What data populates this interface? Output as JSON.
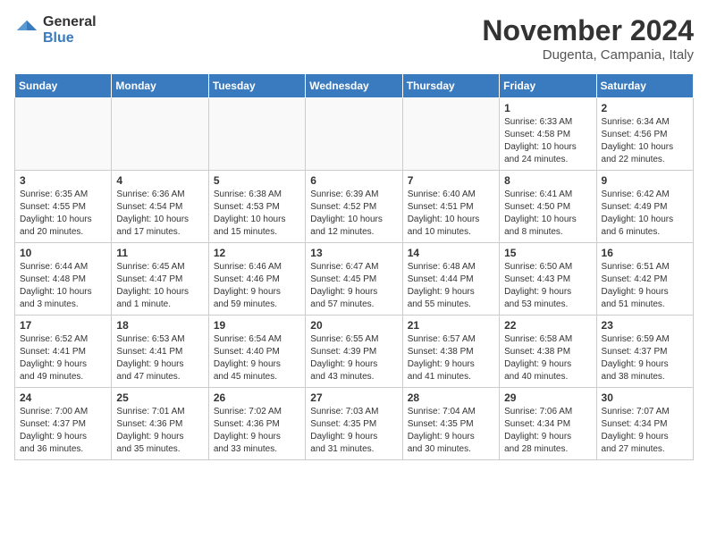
{
  "logo": {
    "general": "General",
    "blue": "Blue"
  },
  "title": "November 2024",
  "subtitle": "Dugenta, Campania, Italy",
  "days_header": [
    "Sunday",
    "Monday",
    "Tuesday",
    "Wednesday",
    "Thursday",
    "Friday",
    "Saturday"
  ],
  "weeks": [
    [
      {
        "day": "",
        "info": ""
      },
      {
        "day": "",
        "info": ""
      },
      {
        "day": "",
        "info": ""
      },
      {
        "day": "",
        "info": ""
      },
      {
        "day": "",
        "info": ""
      },
      {
        "day": "1",
        "info": "Sunrise: 6:33 AM\nSunset: 4:58 PM\nDaylight: 10 hours\nand 24 minutes."
      },
      {
        "day": "2",
        "info": "Sunrise: 6:34 AM\nSunset: 4:56 PM\nDaylight: 10 hours\nand 22 minutes."
      }
    ],
    [
      {
        "day": "3",
        "info": "Sunrise: 6:35 AM\nSunset: 4:55 PM\nDaylight: 10 hours\nand 20 minutes."
      },
      {
        "day": "4",
        "info": "Sunrise: 6:36 AM\nSunset: 4:54 PM\nDaylight: 10 hours\nand 17 minutes."
      },
      {
        "day": "5",
        "info": "Sunrise: 6:38 AM\nSunset: 4:53 PM\nDaylight: 10 hours\nand 15 minutes."
      },
      {
        "day": "6",
        "info": "Sunrise: 6:39 AM\nSunset: 4:52 PM\nDaylight: 10 hours\nand 12 minutes."
      },
      {
        "day": "7",
        "info": "Sunrise: 6:40 AM\nSunset: 4:51 PM\nDaylight: 10 hours\nand 10 minutes."
      },
      {
        "day": "8",
        "info": "Sunrise: 6:41 AM\nSunset: 4:50 PM\nDaylight: 10 hours\nand 8 minutes."
      },
      {
        "day": "9",
        "info": "Sunrise: 6:42 AM\nSunset: 4:49 PM\nDaylight: 10 hours\nand 6 minutes."
      }
    ],
    [
      {
        "day": "10",
        "info": "Sunrise: 6:44 AM\nSunset: 4:48 PM\nDaylight: 10 hours\nand 3 minutes."
      },
      {
        "day": "11",
        "info": "Sunrise: 6:45 AM\nSunset: 4:47 PM\nDaylight: 10 hours\nand 1 minute."
      },
      {
        "day": "12",
        "info": "Sunrise: 6:46 AM\nSunset: 4:46 PM\nDaylight: 9 hours\nand 59 minutes."
      },
      {
        "day": "13",
        "info": "Sunrise: 6:47 AM\nSunset: 4:45 PM\nDaylight: 9 hours\nand 57 minutes."
      },
      {
        "day": "14",
        "info": "Sunrise: 6:48 AM\nSunset: 4:44 PM\nDaylight: 9 hours\nand 55 minutes."
      },
      {
        "day": "15",
        "info": "Sunrise: 6:50 AM\nSunset: 4:43 PM\nDaylight: 9 hours\nand 53 minutes."
      },
      {
        "day": "16",
        "info": "Sunrise: 6:51 AM\nSunset: 4:42 PM\nDaylight: 9 hours\nand 51 minutes."
      }
    ],
    [
      {
        "day": "17",
        "info": "Sunrise: 6:52 AM\nSunset: 4:41 PM\nDaylight: 9 hours\nand 49 minutes."
      },
      {
        "day": "18",
        "info": "Sunrise: 6:53 AM\nSunset: 4:41 PM\nDaylight: 9 hours\nand 47 minutes."
      },
      {
        "day": "19",
        "info": "Sunrise: 6:54 AM\nSunset: 4:40 PM\nDaylight: 9 hours\nand 45 minutes."
      },
      {
        "day": "20",
        "info": "Sunrise: 6:55 AM\nSunset: 4:39 PM\nDaylight: 9 hours\nand 43 minutes."
      },
      {
        "day": "21",
        "info": "Sunrise: 6:57 AM\nSunset: 4:38 PM\nDaylight: 9 hours\nand 41 minutes."
      },
      {
        "day": "22",
        "info": "Sunrise: 6:58 AM\nSunset: 4:38 PM\nDaylight: 9 hours\nand 40 minutes."
      },
      {
        "day": "23",
        "info": "Sunrise: 6:59 AM\nSunset: 4:37 PM\nDaylight: 9 hours\nand 38 minutes."
      }
    ],
    [
      {
        "day": "24",
        "info": "Sunrise: 7:00 AM\nSunset: 4:37 PM\nDaylight: 9 hours\nand 36 minutes."
      },
      {
        "day": "25",
        "info": "Sunrise: 7:01 AM\nSunset: 4:36 PM\nDaylight: 9 hours\nand 35 minutes."
      },
      {
        "day": "26",
        "info": "Sunrise: 7:02 AM\nSunset: 4:36 PM\nDaylight: 9 hours\nand 33 minutes."
      },
      {
        "day": "27",
        "info": "Sunrise: 7:03 AM\nSunset: 4:35 PM\nDaylight: 9 hours\nand 31 minutes."
      },
      {
        "day": "28",
        "info": "Sunrise: 7:04 AM\nSunset: 4:35 PM\nDaylight: 9 hours\nand 30 minutes."
      },
      {
        "day": "29",
        "info": "Sunrise: 7:06 AM\nSunset: 4:34 PM\nDaylight: 9 hours\nand 28 minutes."
      },
      {
        "day": "30",
        "info": "Sunrise: 7:07 AM\nSunset: 4:34 PM\nDaylight: 9 hours\nand 27 minutes."
      }
    ]
  ]
}
